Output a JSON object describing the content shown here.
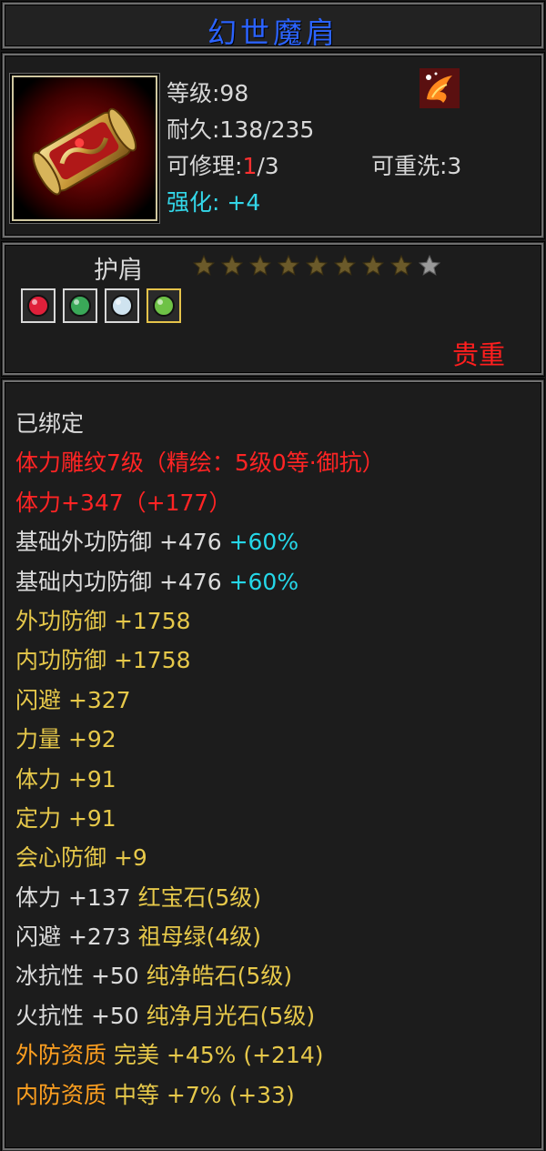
{
  "item": {
    "name": "幻世魔肩",
    "level": "等级:98",
    "durability": "耐久:138/235",
    "repair_label": "可修理:",
    "repair_current": "1",
    "repair_max": "/3",
    "reset": "可重洗:3",
    "enhance": "强化: +4",
    "type": "护肩",
    "stars_filled": 8,
    "stars_total": 9,
    "rarity": "贵重"
  },
  "gems": [
    {
      "icon": "ruby-gem-icon",
      "color": "#e0203a"
    },
    {
      "icon": "emerald-gem-icon",
      "color": "#3aa858"
    },
    {
      "icon": "diamond-gem-icon",
      "color": "#cfe3ef"
    },
    {
      "icon": "moonstone-gem-icon",
      "color": "#6ec246"
    }
  ],
  "attributes": [
    {
      "text": "已绑定",
      "color": "white"
    },
    {
      "text": "体力雕纹7级（精绘：5级0等·御抗）",
      "color": "red"
    },
    {
      "text": "体力+347（+177）",
      "color": "red"
    },
    {
      "text": "基础外功防御 +476 ",
      "extra": "+60%",
      "color": "white"
    },
    {
      "text": "基础内功防御 +476 ",
      "extra": "+60%",
      "color": "white"
    },
    {
      "text": "外功防御 +1758",
      "color": "gold"
    },
    {
      "text": "内功防御 +1758",
      "color": "gold"
    },
    {
      "text": "闪避 +327",
      "color": "gold"
    },
    {
      "text": "力量 +92",
      "color": "gold"
    },
    {
      "text": "体力 +91",
      "color": "gold"
    },
    {
      "text": "定力 +91",
      "color": "gold"
    },
    {
      "text": "会心防御 +9",
      "color": "gold"
    },
    {
      "text": "体力 +137 ",
      "extra": "红宝石(5级)",
      "color": "white",
      "extra_color": "gold"
    },
    {
      "text": "闪避 +273 ",
      "extra": "祖母绿(4级)",
      "color": "white",
      "extra_color": "gold"
    },
    {
      "text": "冰抗性 +50 ",
      "extra": "纯净皓石(5级)",
      "color": "white",
      "extra_color": "gold"
    },
    {
      "text": "火抗性 +50 ",
      "extra": "纯净月光石(5级)",
      "color": "white",
      "extra_color": "gold"
    },
    {
      "text": "外防资质  ",
      "extra": "完美 +45% (+214)",
      "color": "orange",
      "extra_color": "gold"
    },
    {
      "text": "内防资质  ",
      "extra": "中等 +7% (+33)",
      "color": "orange",
      "extra_color": "gold"
    }
  ],
  "colors": {
    "title": "#2b63ff",
    "red": "#ff2424",
    "gold": "#e6c84a",
    "orange": "#ffa020",
    "cyan": "#25d7e8"
  }
}
